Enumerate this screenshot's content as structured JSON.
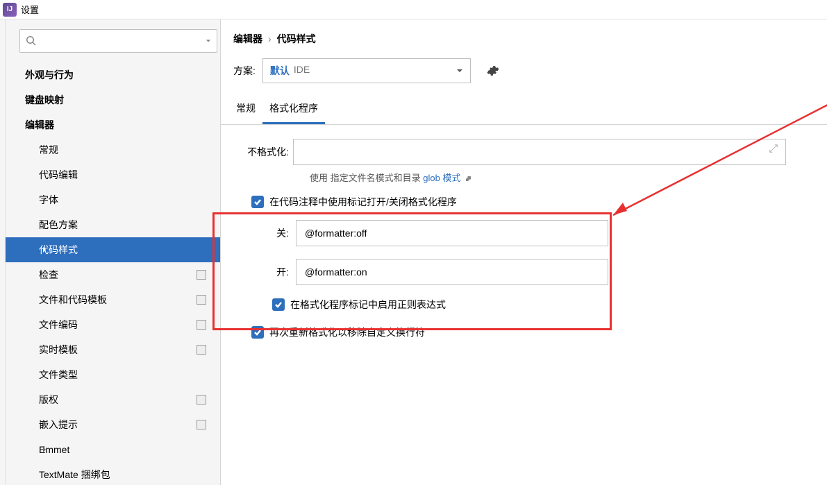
{
  "title": "设置",
  "sidebar": {
    "items": [
      {
        "label": "外观与行为",
        "level": 0,
        "bold": true,
        "chevron": "right"
      },
      {
        "label": "键盘映射",
        "level": 0,
        "bold": true
      },
      {
        "label": "编辑器",
        "level": 0,
        "bold": true,
        "chevron": "down"
      },
      {
        "label": "常规",
        "level": 1,
        "chevron": "right"
      },
      {
        "label": "代码编辑",
        "level": 1
      },
      {
        "label": "字体",
        "level": 1
      },
      {
        "label": "配色方案",
        "level": 1,
        "chevron": "right"
      },
      {
        "label": "代码样式",
        "level": 1,
        "chevron": "right",
        "selected": true
      },
      {
        "label": "检查",
        "level": 1,
        "badge": true
      },
      {
        "label": "文件和代码模板",
        "level": 1,
        "badge": true
      },
      {
        "label": "文件编码",
        "level": 1,
        "badge": true
      },
      {
        "label": "实时模板",
        "level": 1,
        "badge": true
      },
      {
        "label": "文件类型",
        "level": 1
      },
      {
        "label": "版权",
        "level": 1,
        "chevron": "right",
        "badge": true
      },
      {
        "label": "嵌入提示",
        "level": 1,
        "chevron": "right",
        "badge": true
      },
      {
        "label": "Emmet",
        "level": 1,
        "chevron": "right"
      },
      {
        "label": "TextMate 捆绑包",
        "level": 1
      }
    ]
  },
  "breadcrumb": {
    "editor": "编辑器",
    "code_style": "代码样式"
  },
  "scheme": {
    "label": "方案:",
    "default": "默认",
    "ide": "IDE"
  },
  "tabs": {
    "general": "常规",
    "formatter": "格式化程序"
  },
  "main": {
    "no_format_label": "不格式化:",
    "hint_prefix": "使用 指定文件名模式和目录",
    "hint_link": "glob 模式",
    "check_markers": "在代码注释中使用标记打开/关闭格式化程序",
    "off_label": "关:",
    "off_value": "@formatter:off",
    "on_label": "开:",
    "on_value": "@formatter:on",
    "check_regex": "在格式化程序标记中启用正则表达式",
    "check_reformat": "再次重新格式化以移除自定义换行符"
  }
}
